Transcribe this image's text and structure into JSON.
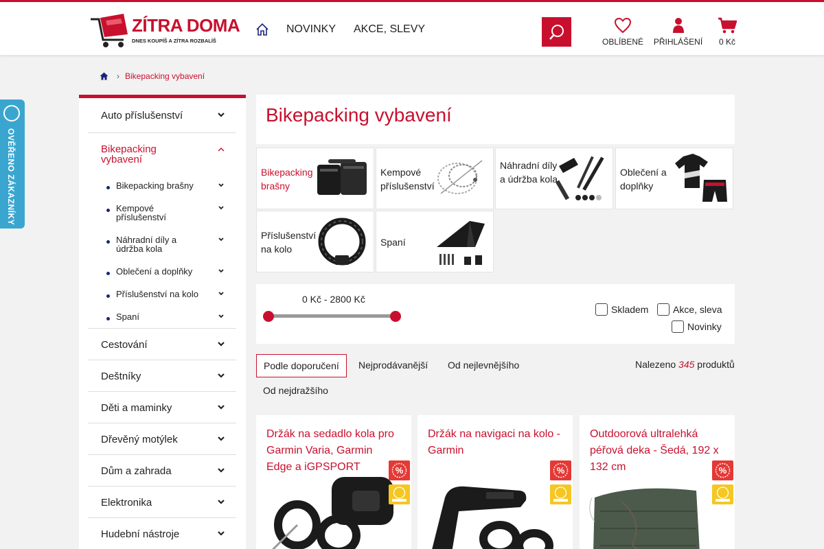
{
  "header": {
    "brand": "ZÍTRA DOMA",
    "tagline": "DNES KOUPÍŠ A ZÍTRA ROZBALÍŠ",
    "nav": [
      "NOVINKY",
      "AKCE, SLEVY"
    ],
    "favorites_label": "OBLÍBENÉ",
    "login_label": "PŘIHLÁŠENÍ",
    "cart_label": "0 Kč"
  },
  "breadcrumb": {
    "current": "Bikepacking vybavení"
  },
  "verified_badge": {
    "text": "OVĚŘENO ZÁKAZNÍKY"
  },
  "sidebar": {
    "categories": [
      {
        "label": "Auto příslušenství"
      },
      {
        "label": "Bikepacking vybavení"
      },
      {
        "label": "Cestování"
      },
      {
        "label": "Deštníky"
      },
      {
        "label": "Děti a maminky"
      },
      {
        "label": "Dřevěný motýlek"
      },
      {
        "label": "Dům a zahrada"
      },
      {
        "label": "Elektronika"
      },
      {
        "label": "Hudební nástroje"
      }
    ],
    "subcategories": [
      {
        "label": "Bikepacking brašny"
      },
      {
        "label": "Kempové příslušenství"
      },
      {
        "label": "Náhradní díly a údržba kola"
      },
      {
        "label": "Oblečení a doplňky"
      },
      {
        "label": "Příslušenství na kolo"
      },
      {
        "label": "Spaní"
      }
    ]
  },
  "main": {
    "title": "Bikepacking vybavení",
    "subcategory_tiles": [
      {
        "label": "Bikepacking brašny"
      },
      {
        "label": "Kempové příslušenství"
      },
      {
        "label": "Náhradní díly a údržba kola"
      },
      {
        "label": "Oblečení a doplňky"
      },
      {
        "label": "Příslušenství na kolo"
      },
      {
        "label": "Spaní"
      }
    ],
    "filters": {
      "price_range": "0 Kč - 2800 Kč",
      "price_min_fraction": 0,
      "price_max_fraction": 1,
      "checkboxes": [
        {
          "label": "Skladem",
          "checked": false
        },
        {
          "label": "Akce, sleva",
          "checked": false
        },
        {
          "label": "Novinky",
          "checked": false
        }
      ]
    },
    "sort": {
      "options": [
        "Podle doporučení",
        "Nejprodávanější",
        "Od nejlevnějšího",
        "Od nejdražšího"
      ],
      "selected": "Podle doporučení"
    },
    "found": {
      "prefix": "Nalezeno",
      "count": "345",
      "suffix": "produktů"
    },
    "products": [
      {
        "title": "Držák na sedadlo kola pro Garmin Varia, Garmin Edge a iGPSPORT"
      },
      {
        "title": "Držák na navigaci na kolo - Garmin"
      },
      {
        "title": "Outdoorová ultralehká péřová deka - Šedá, 192 x 132 cm"
      }
    ]
  },
  "colors": {
    "accent": "#c8102e",
    "badge_blue": "#3aa6d0",
    "sale_red": "#e53935",
    "verified_yellow": "#f6c623"
  }
}
